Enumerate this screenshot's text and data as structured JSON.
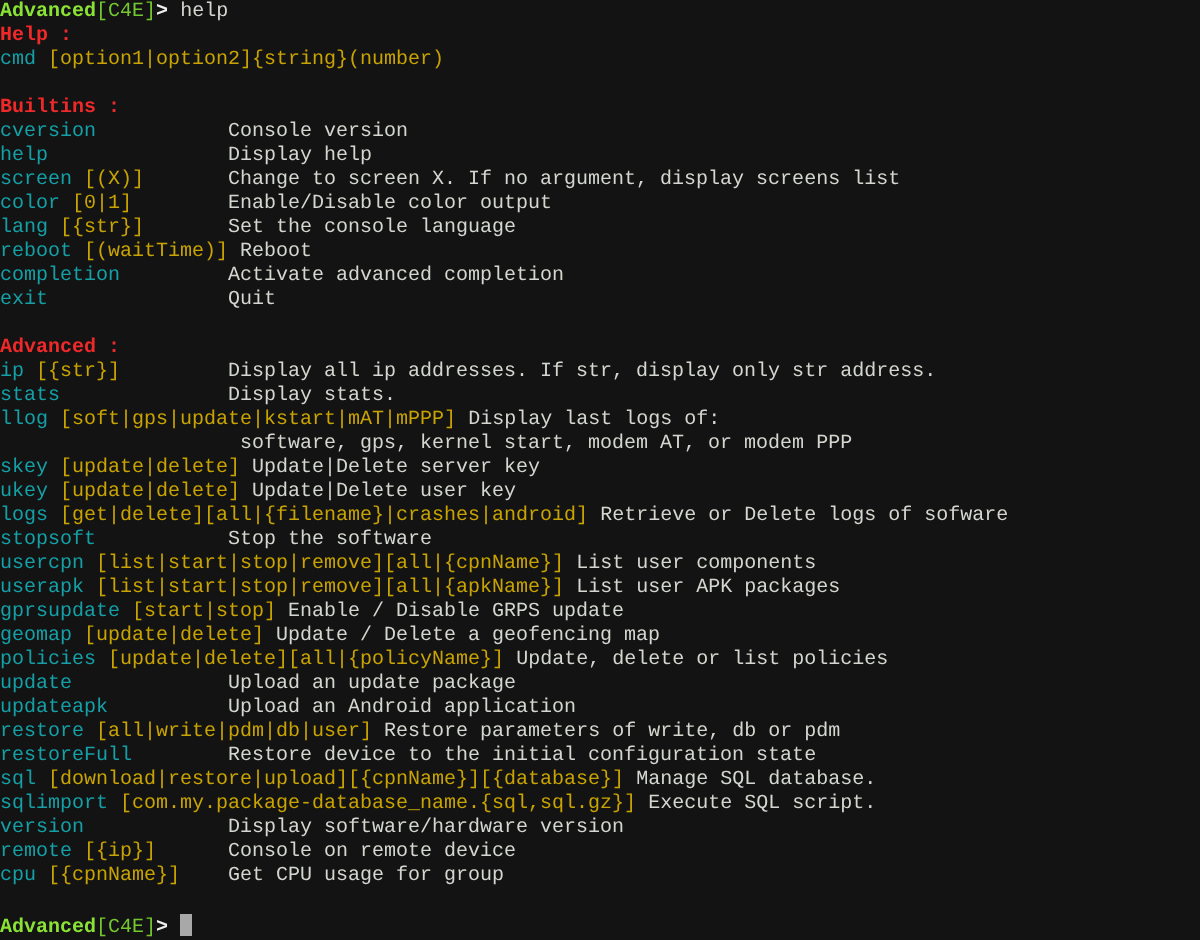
{
  "session": [
    {
      "kind": "prompt",
      "host": "Advanced",
      "tag": "[C4E]",
      "symbol": ">",
      "input": "help"
    },
    {
      "kind": "section",
      "heading": "Help :",
      "commands": [
        {
          "name": "cmd",
          "args": "[option1|option2]{string}(number)"
        }
      ]
    },
    {
      "kind": "section",
      "heading": "Builtins :",
      "commands": [
        {
          "name": "cversion",
          "description": "Console version"
        },
        {
          "name": "help",
          "description": "Display help"
        },
        {
          "name": "screen",
          "args": "[(X)]",
          "description": "Change to screen X. If no argument, display screens list"
        },
        {
          "name": "color",
          "args": "[0|1]",
          "description": "Enable/Disable color output"
        },
        {
          "name": "lang",
          "args": "[{str}]",
          "description": "Set the console language"
        },
        {
          "name": "reboot",
          "args": "[(waitTime)]",
          "description": "Reboot"
        },
        {
          "name": "completion",
          "description": "Activate advanced completion"
        },
        {
          "name": "exit",
          "description": "Quit"
        }
      ]
    },
    {
      "kind": "section",
      "heading": "Advanced :",
      "commands": [
        {
          "name": "ip",
          "args": "[{str}]",
          "description": "Display all ip addresses. If str, display only str address."
        },
        {
          "name": "stats",
          "description": "Display stats."
        },
        {
          "name": "llog",
          "args": "[soft|gps|update|kstart|mAT|mPPP]",
          "description": "Display last logs of:",
          "continuation": "software, gps, kernel start, modem AT, or modem PPP"
        },
        {
          "name": "skey",
          "args": "[update|delete]",
          "description": "Update|Delete server key"
        },
        {
          "name": "ukey",
          "args": "[update|delete]",
          "description": "Update|Delete user key"
        },
        {
          "name": "logs",
          "args": "[get|delete][all|{filename}|crashes|android]",
          "description": "Retrieve or Delete logs of sofware"
        },
        {
          "name": "stopsoft",
          "description": "Stop the software"
        },
        {
          "name": "usercpn",
          "args": "[list|start|stop|remove][all|{cpnName}]",
          "description": "List user components"
        },
        {
          "name": "userapk",
          "args": "[list|start|stop|remove][all|{apkName}]",
          "description": "List user APK packages"
        },
        {
          "name": "gprsupdate",
          "args": "[start|stop]",
          "description": "Enable / Disable GRPS update"
        },
        {
          "name": "geomap",
          "args": "[update|delete]",
          "description": "Update / Delete a geofencing map"
        },
        {
          "name": "policies",
          "args": "[update|delete][all|{policyName}]",
          "description": "Update, delete or list policies"
        },
        {
          "name": "update",
          "description": "Upload an update package"
        },
        {
          "name": "updateapk",
          "description": "Upload an Android application"
        },
        {
          "name": "restore",
          "args": "[all|write|pdm|db|user]",
          "description": "Restore parameters of write, db or pdm"
        },
        {
          "name": "restoreFull",
          "description": "Restore device to the initial configuration state"
        },
        {
          "name": "sql",
          "args": "[download|restore|upload][{cpnName}][{database}]",
          "description": "Manage SQL database."
        },
        {
          "name": "sqlimport",
          "args": "[com.my.package-database_name.{sql,sql.gz}]",
          "description": "Execute SQL script."
        },
        {
          "name": "version",
          "description": "Display software/hardware version"
        },
        {
          "name": "remote",
          "args": "[{ip}]",
          "description": "Console on remote device"
        },
        {
          "name": "cpu",
          "args": "[{cpnName}]",
          "description": "Get CPU usage for group"
        }
      ]
    },
    {
      "kind": "prompt",
      "host": "Advanced",
      "tag": "[C4E]",
      "symbol": ">",
      "cursor": true
    }
  ]
}
